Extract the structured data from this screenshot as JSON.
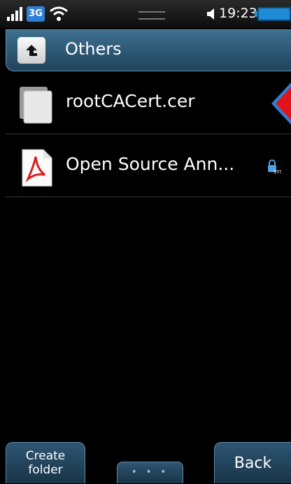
{
  "status_bar": {
    "network": "3G",
    "time": "19:23"
  },
  "header": {
    "title": "Others",
    "up_icon": "up-arrow-icon"
  },
  "files": [
    {
      "name": "rootCACert.cer",
      "icon": "generic-file-icon"
    },
    {
      "name": "Open Source Ann...",
      "icon": "pdf-file-icon",
      "badge_icon": "sys-lock-icon"
    }
  ],
  "bottom_bar": {
    "left_label_line1": "Create",
    "left_label_line2": "folder",
    "center_label": "• • •",
    "right_label": "Back"
  },
  "colors": {
    "accent": "#2f7fd6",
    "header": "#2f5a77",
    "arrow": "#e0141c"
  }
}
